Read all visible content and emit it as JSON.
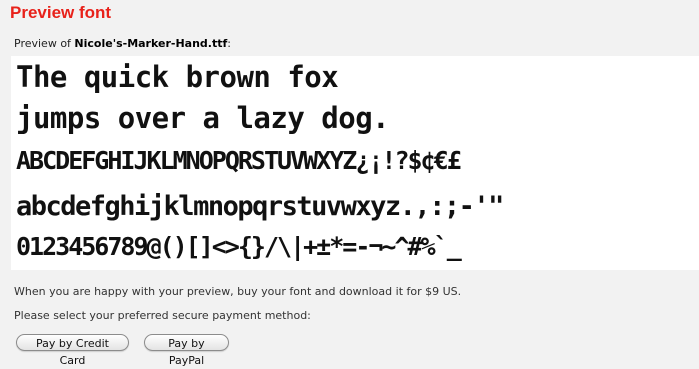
{
  "heading": "Preview font",
  "preview_of": {
    "prefix": "Preview of",
    "font_file": "Nicole's-Marker-Hand.ttf",
    "suffix": ":"
  },
  "sample_lines": [
    "The quick brown fox",
    "jumps over a lazy dog.",
    "ABCDEFGHIJKLMNOPQRSTUVWXYZ¿¡!?$¢€£",
    "abcdefghijklmnopqrstuvwxyz.,:;-'\"",
    "0123456789@()[]<>{}/\\|+±*=-¬~^#%`_"
  ],
  "messages": {
    "happy": "When you are happy with your preview, buy your font and download it for $9 US.",
    "select": "Please select your preferred secure payment method:"
  },
  "buttons": {
    "credit_card": "Pay by Credit Card",
    "paypal": "Pay by PayPal"
  },
  "colors": {
    "heading": "#e8211a",
    "page_background": "#f2f2f2",
    "sample_background": "#ffffff"
  }
}
